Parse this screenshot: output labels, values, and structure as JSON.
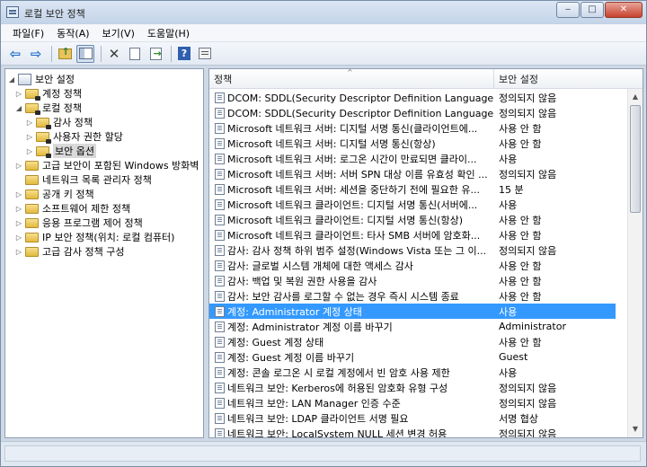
{
  "window": {
    "title": "로컬 보안 정책",
    "minimize_glyph": "‒",
    "maximize_glyph": "□",
    "close_glyph": "✕"
  },
  "menu": [
    "파일(F)",
    "동작(A)",
    "보기(V)",
    "도움말(H)"
  ],
  "toolbar": {
    "icons": [
      "back-icon",
      "forward-icon",
      "up-folder-icon",
      "show-tree-icon",
      "delete-icon",
      "properties-icon",
      "export-list-icon",
      "help-icon",
      "view-icon"
    ]
  },
  "tree": [
    {
      "label": "보안 설정",
      "level": 0,
      "expander": "◢",
      "icon": "root"
    },
    {
      "label": "계정 정책",
      "level": 1,
      "expander": "▷",
      "icon": "folder-lock"
    },
    {
      "label": "로컬 정책",
      "level": 1,
      "expander": "◢",
      "icon": "folder-lock"
    },
    {
      "label": "감사 정책",
      "level": 2,
      "expander": "▷",
      "icon": "folder-lock"
    },
    {
      "label": "사용자 권한 할당",
      "level": 2,
      "expander": "▷",
      "icon": "folder-lock"
    },
    {
      "label": "보안 옵션",
      "level": 2,
      "expander": "▷",
      "icon": "folder-lock",
      "selected": true
    },
    {
      "label": "고급 보안이 포함된 Windows 방화벽",
      "level": 1,
      "expander": "▷",
      "icon": "folder"
    },
    {
      "label": "네트워크 목록 관리자 정책",
      "level": 1,
      "expander": "",
      "icon": "folder"
    },
    {
      "label": "공개 키 정책",
      "level": 1,
      "expander": "▷",
      "icon": "folder"
    },
    {
      "label": "소프트웨어 제한 정책",
      "level": 1,
      "expander": "▷",
      "icon": "folder"
    },
    {
      "label": "응용 프로그램 제어 정책",
      "level": 1,
      "expander": "▷",
      "icon": "folder"
    },
    {
      "label": "IP 보안 정책(위치: 로컬 컴퓨터)",
      "level": 1,
      "expander": "▷",
      "icon": "folder"
    },
    {
      "label": "고급 감사 정책 구성",
      "level": 1,
      "expander": "▷",
      "icon": "folder"
    }
  ],
  "list": {
    "columns": [
      "정책",
      "보안 설정"
    ],
    "sort_glyph": "^",
    "rows": [
      {
        "policy": "DCOM: SDDL(Security Descriptor Definition Language) 구...",
        "setting": "정의되지 않음"
      },
      {
        "policy": "DCOM: SDDL(Security Descriptor Definition Language) 구...",
        "setting": "정의되지 않음"
      },
      {
        "policy": "Microsoft 네트워크 서버: 디지털 서명 통신(클라이언트에...",
        "setting": "사용 안 함"
      },
      {
        "policy": "Microsoft 네트워크 서버: 디지털 서명 통신(항상)",
        "setting": "사용 안 함"
      },
      {
        "policy": "Microsoft 네트워크 서버: 로그온 시간이 만료되면 클라이...",
        "setting": "사용"
      },
      {
        "policy": "Microsoft 네트워크 서버: 서버 SPN 대상 이름 유효성 확인 ...",
        "setting": "정의되지 않음"
      },
      {
        "policy": "Microsoft 네트워크 서버: 세션을 중단하기 전에 필요한 유...",
        "setting": "15 분"
      },
      {
        "policy": "Microsoft 네트워크 클라이언트: 디지털 서명 통신(서버에...",
        "setting": "사용"
      },
      {
        "policy": "Microsoft 네트워크 클라이언트: 디지털 서명 통신(항상)",
        "setting": "사용 안 함"
      },
      {
        "policy": "Microsoft 네트워크 클라이언트: 타사 SMB 서버에 암호화...",
        "setting": "사용 안 함"
      },
      {
        "policy": "감사: 감사 정책 하위 범주 설정(Windows Vista 또는 그 이...",
        "setting": "정의되지 않음"
      },
      {
        "policy": "감사: 글로벌 시스템 개체에 대한 액세스 감사",
        "setting": "사용 안 함"
      },
      {
        "policy": "감사: 백업 및 복원 권한 사용을 감사",
        "setting": "사용 안 함"
      },
      {
        "policy": "감사: 보안 감사를 로그할 수 없는 경우 즉시 시스템 종료",
        "setting": "사용 안 함"
      },
      {
        "policy": "계정: Administrator 계정 상태",
        "setting": "사용",
        "selected": true
      },
      {
        "policy": "계정: Administrator 계정 이름 바꾸기",
        "setting": "Administrator"
      },
      {
        "policy": "계정: Guest 계정 상태",
        "setting": "사용 안 함"
      },
      {
        "policy": "계정: Guest 계정 이름 바꾸기",
        "setting": "Guest"
      },
      {
        "policy": "계정: 콘솔 로그온 시 로컬 계정에서 빈 암호 사용 제한",
        "setting": "사용"
      },
      {
        "policy": "네트워크 보안: Kerberos에 허용된 암호화 유형 구성",
        "setting": "정의되지 않음"
      },
      {
        "policy": "네트워크 보안: LAN Manager 인증 수준",
        "setting": "정의되지 않음"
      },
      {
        "policy": "네트워크 보안: LDAP 클라이언트 서명 필요",
        "setting": "서명 협상"
      },
      {
        "policy": "네트워크 보안: LocalSystem NULL 세션 변경 허용",
        "setting": "정의되지 않음"
      }
    ]
  },
  "scrollbar": {
    "up_glyph": "▲",
    "down_glyph": "▼"
  }
}
